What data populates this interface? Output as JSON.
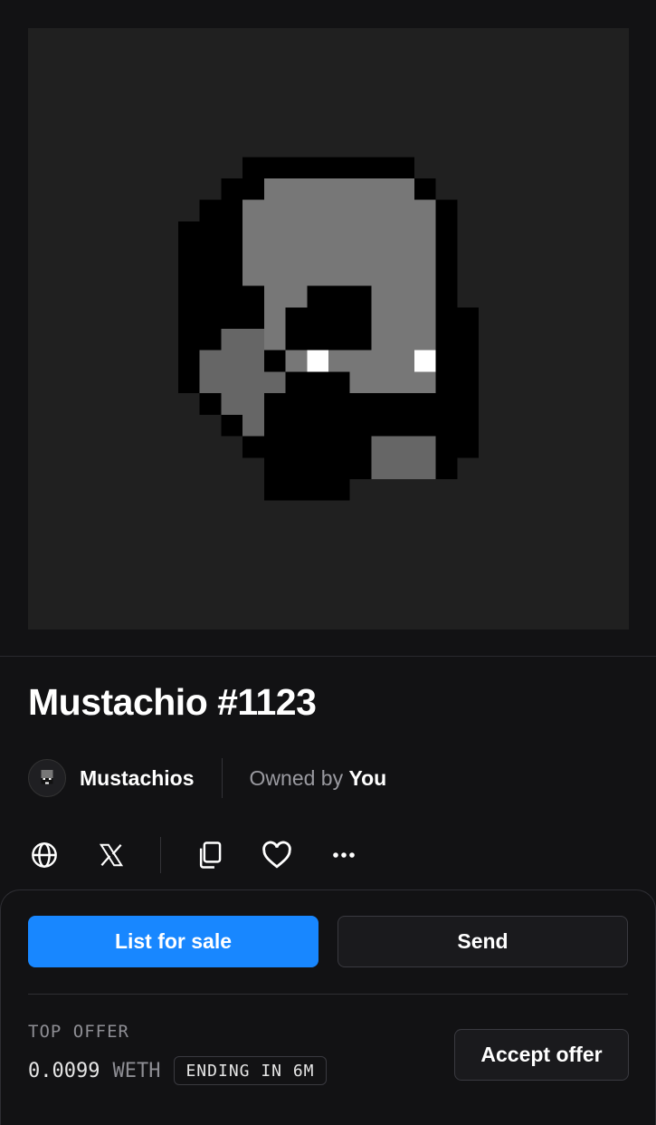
{
  "nft": {
    "title": "Mustachio #1123",
    "image_alt": "pixel art mustachio portrait"
  },
  "collection": {
    "name": "Mustachios",
    "owned_prefix": "Owned by",
    "owner": "You"
  },
  "actions": {
    "icons": [
      "globe-icon",
      "x-logo-icon",
      "copy-icon",
      "heart-icon",
      "more-icon"
    ]
  },
  "panel": {
    "list_label": "List for sale",
    "send_label": "Send",
    "top_offer_label": "TOP OFFER",
    "offer_amount": "0.0099",
    "offer_currency": "WETH",
    "offer_expiry": "ENDING IN 6M",
    "accept_label": "Accept offer"
  },
  "colors": {
    "background": "#121214",
    "art_background": "#202020",
    "primary_button": "#1887ff"
  }
}
